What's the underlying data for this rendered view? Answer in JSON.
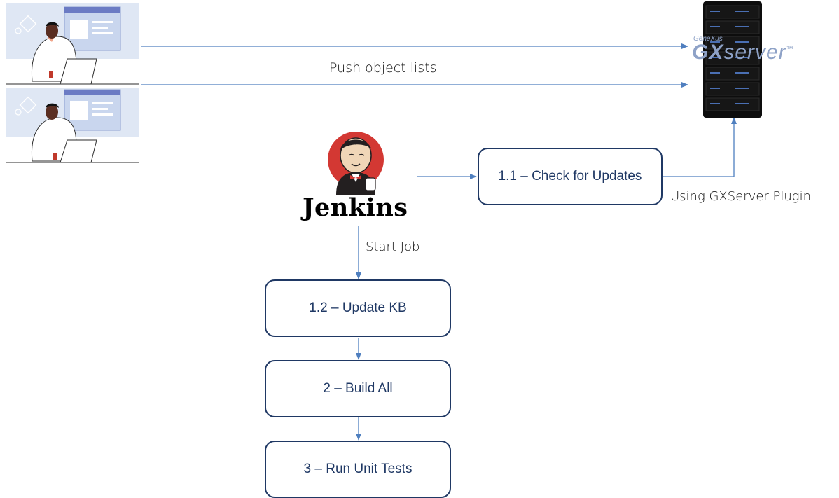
{
  "messages": {
    "push_label": "Push object lists",
    "plugin_label": "Using GXServer Plugin",
    "start_job_label": "Start Job"
  },
  "jenkins": {
    "wordmark": "Jenkins"
  },
  "gxserver": {
    "brand_small": "GeneXus",
    "brand_big_prefix": "GX",
    "brand_big_suffix": "server",
    "trademark": "™"
  },
  "steps": {
    "check_updates": "1.1 – Check for Updates",
    "update_kb": "1.2 – Update KB",
    "build_all": "2 – Build All",
    "run_tests": "3 – Run Unit Tests"
  },
  "colors": {
    "arrow": "#4f7fbf",
    "box_border": "#1f3864",
    "box_text": "#1f3864"
  }
}
